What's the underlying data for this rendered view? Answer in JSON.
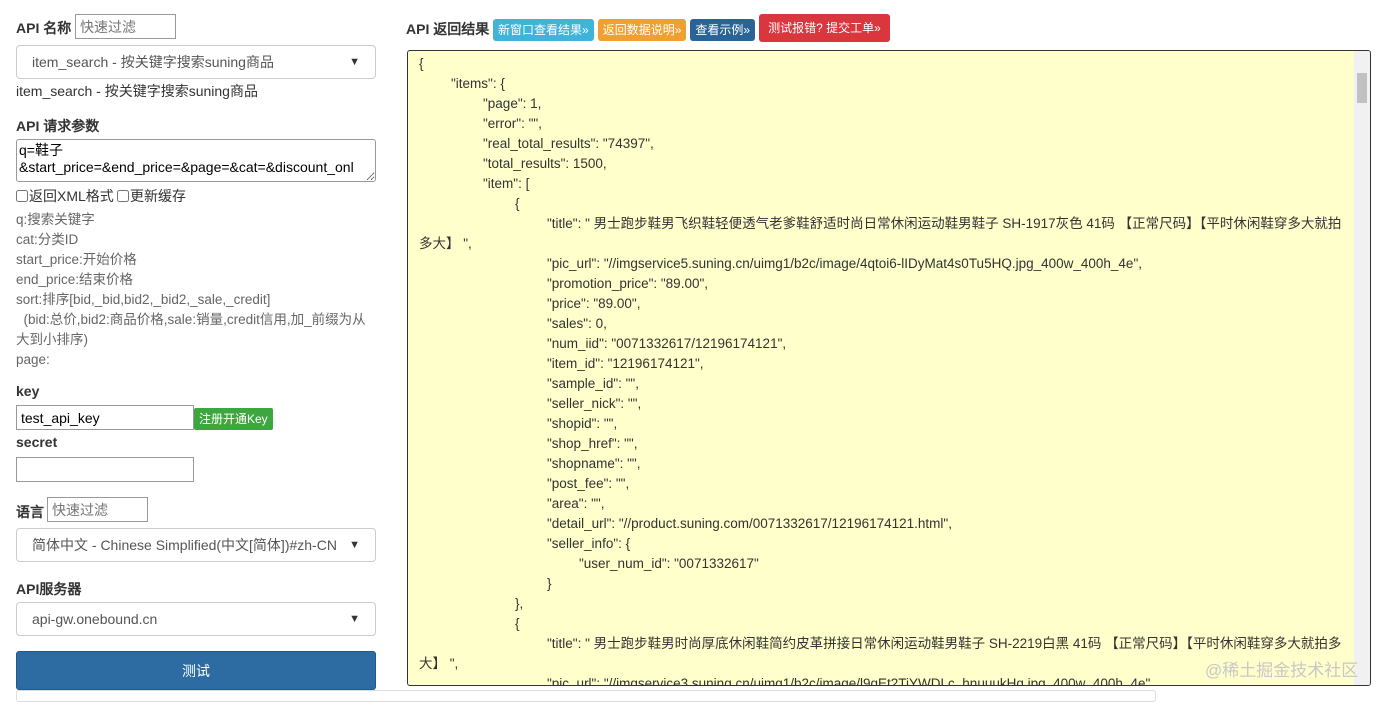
{
  "left": {
    "api_name_label": "API 名称",
    "filter_placeholder": "快速过滤",
    "api_select": "item_search - 按关键字搜索suning商品",
    "api_desc": "item_search - 按关键字搜索suning商品",
    "params_label": "API 请求参数",
    "params_value": "q=鞋子\n&start_price=&end_price=&page=&cat=&discount_onl",
    "xml_checkbox": "返回XML格式",
    "cache_checkbox": "更新缓存",
    "param_help": [
      "q:搜索关键字",
      "cat:分类ID",
      "start_price:开始价格",
      "end_price:结束价格",
      "sort:排序[bid,_bid,bid2,_bid2,_sale,_credit]",
      "  (bid:总价,bid2:商品价格,sale:销量,credit信用,加_前缀为从大到小排序)",
      "page:"
    ],
    "key_label": "key",
    "key_value": "test_api_key",
    "register_button": "注册开通Key",
    "secret_label": "secret",
    "secret_value": "",
    "lang_label": "语言",
    "lang_filter_placeholder": "快速过滤",
    "lang_select": "简体中文 - Chinese Simplified(中文[简体])#zh-CN",
    "server_label": "API服务器",
    "server_select": "api-gw.onebound.cn",
    "test_button": "测试"
  },
  "right": {
    "title": "API 返回结果",
    "buttons": [
      {
        "label": "新窗口查看结果»",
        "color": "#3fb4d8"
      },
      {
        "label": "返回数据说明»",
        "color": "#f0a030"
      },
      {
        "label": "查看示例»",
        "color": "#2a6496"
      },
      {
        "label": "测试报错? 提交工单»",
        "color": "#d9363e"
      }
    ],
    "response_text": "{\n\t\"items\": {\n\t\t\"page\": 1,\n\t\t\"error\": \"\",\n\t\t\"real_total_results\": \"74397\",\n\t\t\"total_results\": 1500,\n\t\t\"item\": [\n\t\t\t{\n\t\t\t\t\"title\": \" 男士跑步鞋男飞织鞋轻便透气老爹鞋舒适时尚日常休闲运动鞋男鞋子 SH-1917灰色 41码 【正常尺码】【平时休闲鞋穿多大就拍多大】 \",\n\t\t\t\t\"pic_url\": \"//imgservice5.suning.cn/uimg1/b2c/image/4qtoi6-lIDyMat4s0Tu5HQ.jpg_400w_400h_4e\",\n\t\t\t\t\"promotion_price\": \"89.00\",\n\t\t\t\t\"price\": \"89.00\",\n\t\t\t\t\"sales\": 0,\n\t\t\t\t\"num_iid\": \"0071332617/12196174121\",\n\t\t\t\t\"item_id\": \"12196174121\",\n\t\t\t\t\"sample_id\": \"\",\n\t\t\t\t\"seller_nick\": \"\",\n\t\t\t\t\"shopid\": \"\",\n\t\t\t\t\"shop_href\": \"\",\n\t\t\t\t\"shopname\": \"\",\n\t\t\t\t\"post_fee\": \"\",\n\t\t\t\t\"area\": \"\",\n\t\t\t\t\"detail_url\": \"//product.suning.com/0071332617/12196174121.html\",\n\t\t\t\t\"seller_info\": {\n\t\t\t\t\t\"user_num_id\": \"0071332617\"\n\t\t\t\t}\n\t\t\t},\n\t\t\t{\n\t\t\t\t\"title\": \" 男士跑步鞋男时尚厚底休闲鞋简约皮革拼接日常休闲运动鞋男鞋子 SH-2219白黑 41码 【正常尺码】【平时休闲鞋穿多大就拍多大】 \",\n\t\t\t\t\"pic_url\": \"//imgservice3.suning.cn/uimg1/b2c/image/l9gEt2TiYWDLc_hnuuukHg.jpg_400w_400h_4e\","
  },
  "watermark": "@稀土掘金技术社区"
}
